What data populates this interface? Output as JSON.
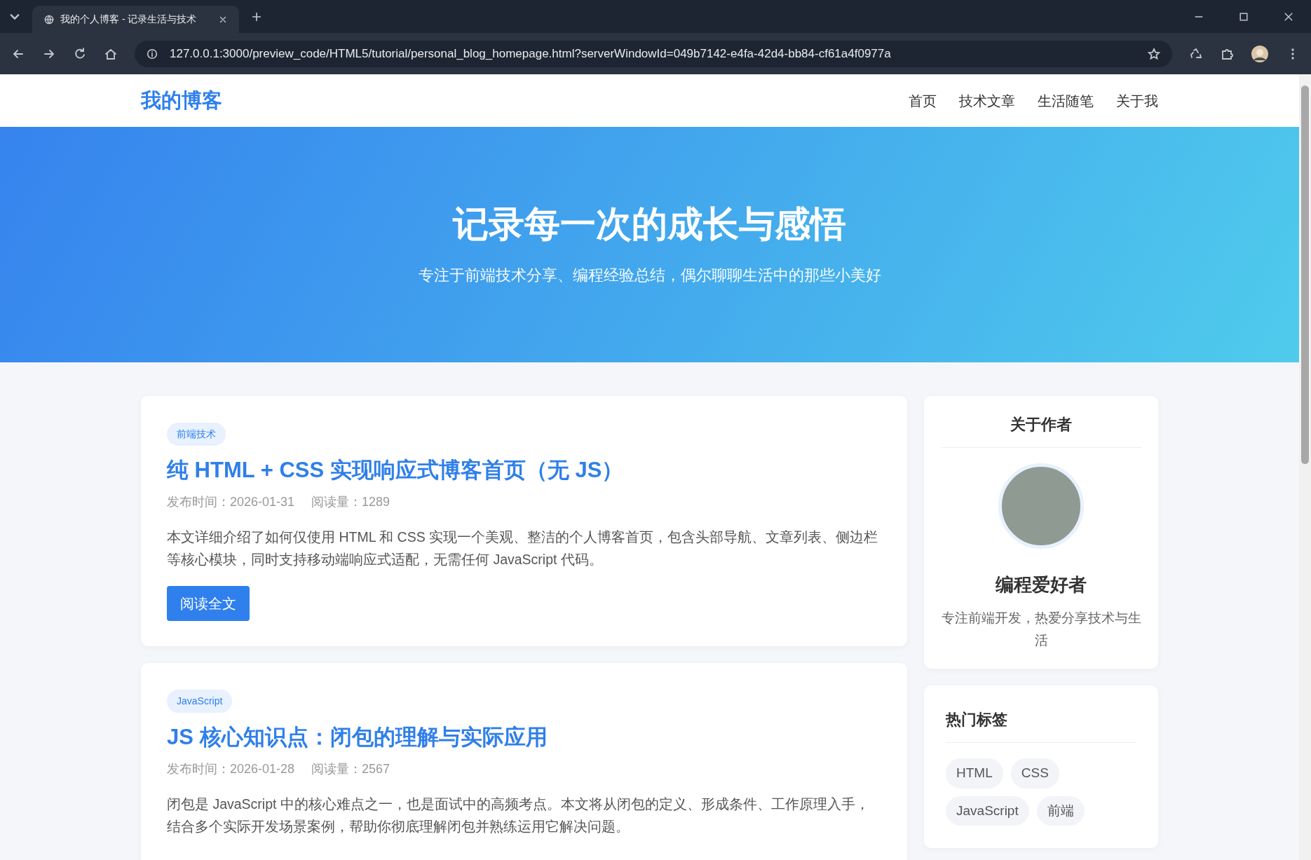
{
  "browser": {
    "tab_title": "我的个人博客 - 记录生活与技术",
    "url": "127.0.0.1:3000/preview_code/HTML5/tutorial/personal_blog_homepage.html?serverWindowId=049b7142-e4fa-42d4-bb84-cf61a4f0977a"
  },
  "site": {
    "logo": "我的博客",
    "nav": [
      {
        "label": "首页"
      },
      {
        "label": "技术文章"
      },
      {
        "label": "生活随笔"
      },
      {
        "label": "关于我"
      }
    ]
  },
  "hero": {
    "title": "记录每一次的成长与感悟",
    "subtitle": "专注于前端技术分享、编程经验总结，偶尔聊聊生活中的那些小美好"
  },
  "articles": [
    {
      "tag": "前端技术",
      "title": "纯 HTML + CSS 实现响应式博客首页（无 JS）",
      "date": "发布时间：2026-01-31",
      "views": "阅读量：1289",
      "excerpt": "本文详细介绍了如何仅使用 HTML 和 CSS 实现一个美观、整洁的个人博客首页，包含头部导航、文章列表、侧边栏等核心模块，同时支持移动端响应式适配，无需任何 JavaScript 代码。",
      "button": "阅读全文"
    },
    {
      "tag": "JavaScript",
      "title": "JS 核心知识点：闭包的理解与实际应用",
      "date": "发布时间：2026-01-28",
      "views": "阅读量：2567",
      "excerpt": "闭包是 JavaScript 中的核心难点之一，也是面试中的高频考点。本文将从闭包的定义、形成条件、工作原理入手，结合多个实际开发场景案例，帮助你彻底理解闭包并熟练运用它解决问题。"
    }
  ],
  "sidebar": {
    "about": {
      "title": "关于作者",
      "name": "编程爱好者",
      "bio": "专注前端开发，热爱分享技术与生活"
    },
    "tags": {
      "title": "热门标签",
      "items": [
        "HTML",
        "CSS",
        "JavaScript",
        "前端"
      ]
    }
  }
}
